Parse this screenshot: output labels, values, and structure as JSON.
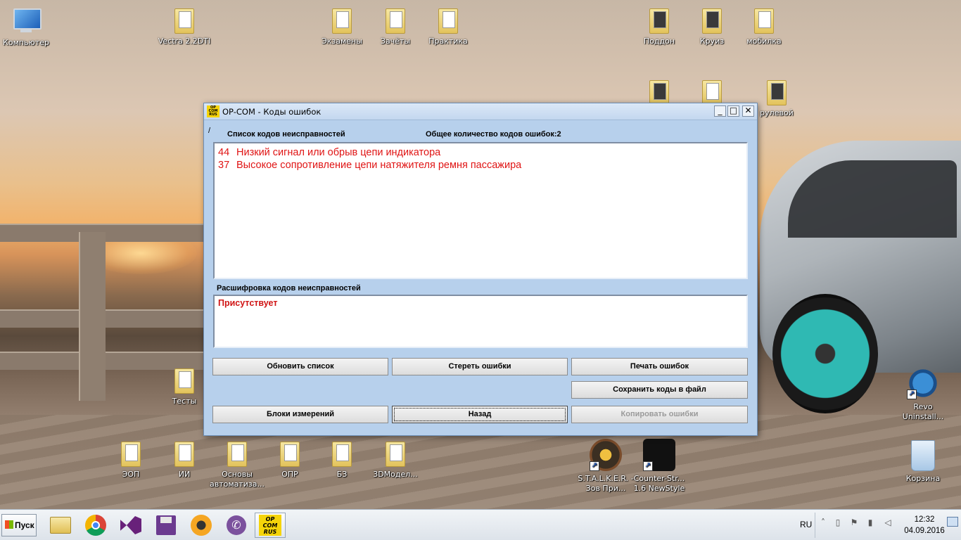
{
  "desktop": {
    "icons": [
      {
        "name": "computer-icon",
        "label": "Компьютер"
      },
      {
        "name": "folder-vectra-icon",
        "label": "Vectra 2.2DTI"
      },
      {
        "name": "folder-ekzameny-icon",
        "label": "Экзамены"
      },
      {
        "name": "folder-zachety-icon",
        "label": "Зачёты"
      },
      {
        "name": "folder-praktika-icon",
        "label": "Практика"
      },
      {
        "name": "folder-poddon-icon",
        "label": "Поддон"
      },
      {
        "name": "folder-kruiz-icon",
        "label": "Круиз"
      },
      {
        "name": "folder-mobilka-icon",
        "label": "мобилка"
      },
      {
        "name": "folder-rulevoy-icon",
        "label": "рулевой"
      },
      {
        "name": "folder-testy-icon",
        "label": "Тесты"
      },
      {
        "name": "folder-eop-icon",
        "label": "ЭОП"
      },
      {
        "name": "folder-ii-icon",
        "label": "ИИ"
      },
      {
        "name": "folder-osnovy-icon",
        "label": "Основы автоматиза..."
      },
      {
        "name": "folder-opr-icon",
        "label": "ОПР"
      },
      {
        "name": "folder-bz-icon",
        "label": "БЗ"
      },
      {
        "name": "folder-3dmodel-icon",
        "label": "3DМодел..."
      },
      {
        "name": "stalker-shortcut-icon",
        "label": "S.T.A.L.K.E.R. - Зов При..."
      },
      {
        "name": "counter-strike-shortcut-icon",
        "label": "Counter-Str... 1.6 NewStyle"
      },
      {
        "name": "revo-uninstaller-icon",
        "label": "Revo Uninstall..."
      },
      {
        "name": "recycle-bin-icon",
        "label": "Корзина"
      }
    ]
  },
  "window": {
    "logo": "OP COM RUS",
    "title": "OP-COM - Коды ошибок",
    "minimize": "_",
    "maximize": "□",
    "close": "✕",
    "slash": "/",
    "list_label": "Список кодов неисправностей",
    "total_label": "Общее количество кодов ошибок:2",
    "codes": [
      {
        "code": "44",
        "text": "Низкий сигнал или обрыв цепи индикатора"
      },
      {
        "code": "37",
        "text": "Высокое сопротивление цепи натяжителя ремня пассажира"
      }
    ],
    "decode_label": "Расшифровка кодов неисправностей",
    "decode_text": "Присутствует",
    "buttons": {
      "refresh": "Обновить список",
      "erase": "Стереть ошибки",
      "print": "Печать ошибок",
      "save": "Сохранить коды в файл",
      "blocks": "Блоки измерений",
      "back": "Назад",
      "copy": "Копировать ошибки"
    }
  },
  "taskbar": {
    "start_label": "Пуск",
    "active_logo": "OP COM RUS",
    "language": "RU",
    "time": "12:32",
    "date": "04.09.2016"
  }
}
